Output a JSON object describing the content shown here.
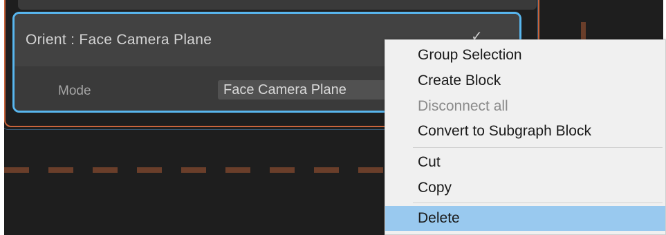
{
  "block": {
    "title": "Orient : Face Camera Plane",
    "enabled_check": "✓",
    "mode_label": "Mode",
    "mode_value": "Face Camera Plane"
  },
  "context_menu": {
    "items": [
      {
        "label": "Group Selection",
        "state": "enabled"
      },
      {
        "label": "Create Block",
        "state": "enabled"
      },
      {
        "label": "Disconnect all",
        "state": "disabled"
      },
      {
        "label": "Convert to Subgraph Block",
        "state": "enabled"
      },
      {
        "label": "Cut",
        "state": "enabled"
      },
      {
        "label": "Copy",
        "state": "enabled"
      },
      {
        "label": "Delete",
        "state": "highlighted"
      }
    ]
  },
  "colors": {
    "selection_outline": "#58b6ee",
    "context_outline": "#c8643c",
    "menu_highlight": "#99c9ef",
    "canvas_bg": "#1e1e1e"
  }
}
